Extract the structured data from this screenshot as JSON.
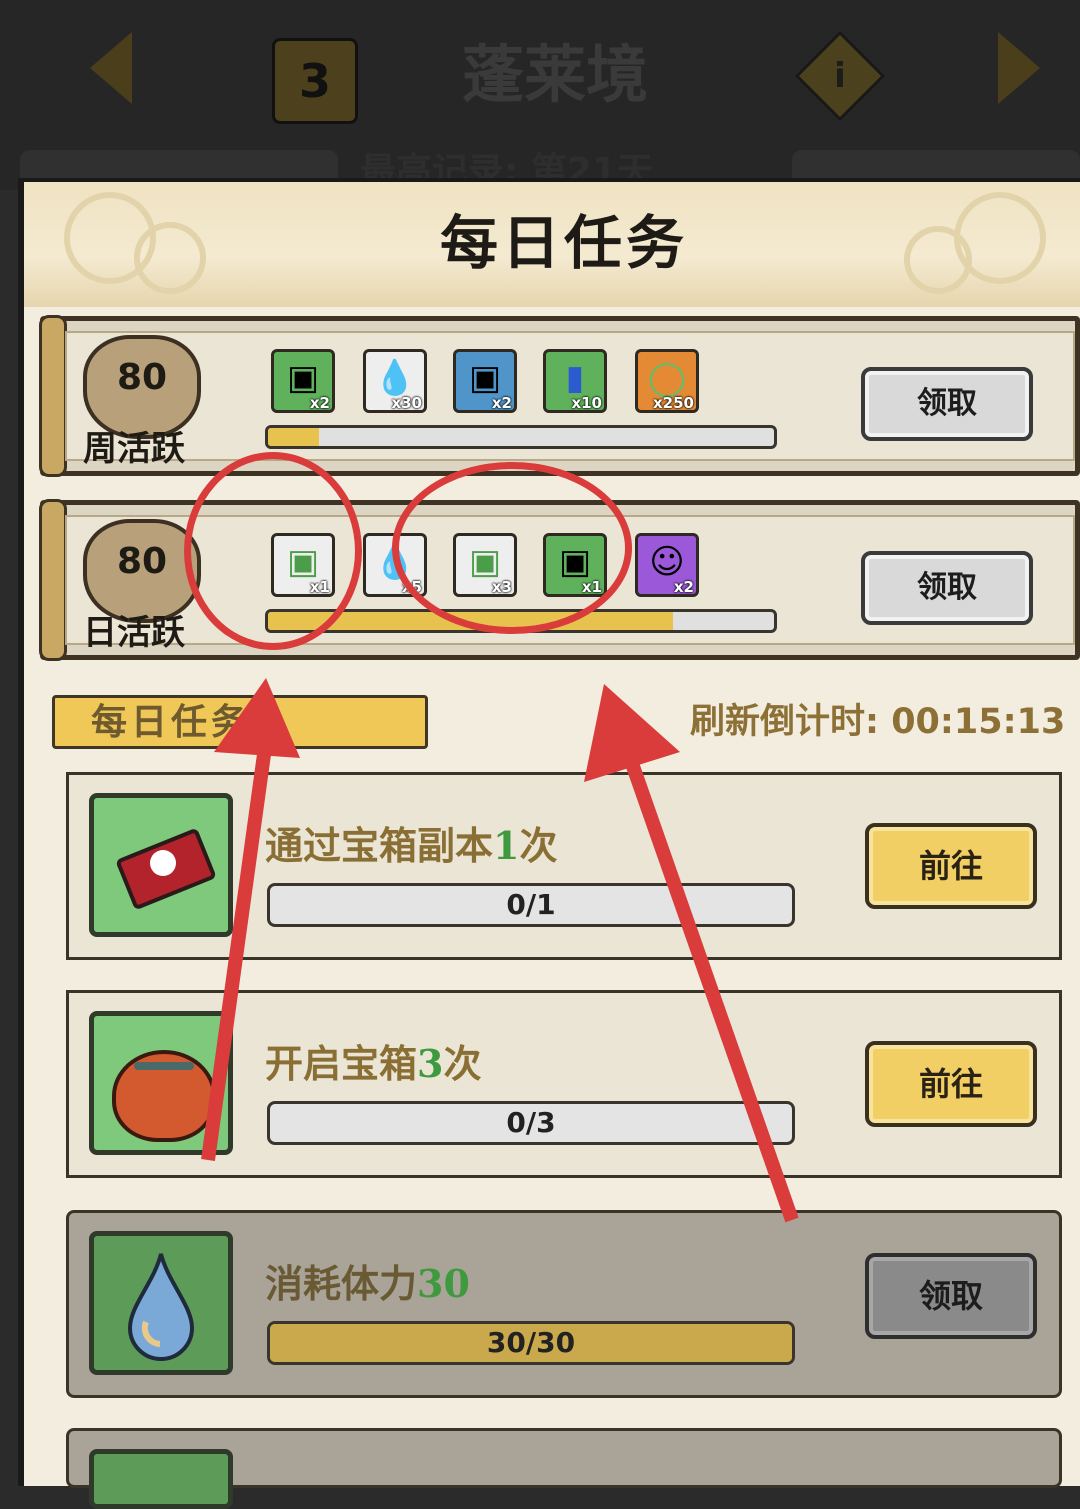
{
  "header": {
    "level": "3",
    "region_title": "蓬莱境",
    "info_icon": "info-icon",
    "record_text": "最高记录: 第21天"
  },
  "panel": {
    "title": "每日任务"
  },
  "weekly": {
    "points": "80",
    "label": "周活跃",
    "progress": 0.1,
    "claim_label": "领取",
    "rewards": [
      {
        "icon": "green-chest-icon",
        "qty": "x2"
      },
      {
        "icon": "water-drop-icon",
        "qty": "x30"
      },
      {
        "icon": "blue-chest-icon",
        "qty": "x2"
      },
      {
        "icon": "blue-card-icon",
        "qty": "x10"
      },
      {
        "icon": "jade-ring-icon",
        "qty": "x250"
      }
    ]
  },
  "daily": {
    "points": "80",
    "label": "日活跃",
    "progress": 0.8,
    "claim_label": "领取",
    "rewards": [
      {
        "icon": "gray-chest-icon",
        "qty": "x1"
      },
      {
        "icon": "water-drop-icon",
        "qty": "x5"
      },
      {
        "icon": "gray-chest-icon",
        "qty": "x3"
      },
      {
        "icon": "green-chest-icon",
        "qty": "x1"
      },
      {
        "icon": "hero-portrait-icon",
        "qty": "x2"
      }
    ]
  },
  "section": {
    "tag": "每日任务",
    "refresh_label": "刷新倒计时: ",
    "refresh_time": "00:15:13"
  },
  "tasks": [
    {
      "icon": "red-ticket-icon",
      "title_pre": "通过宝箱副本",
      "title_num": "1",
      "title_post": "次",
      "progress_text": "0/1",
      "progress": 0.0,
      "button": "前往",
      "state": "go"
    },
    {
      "icon": "red-pouch-icon",
      "title_pre": "开启宝箱",
      "title_num": "3",
      "title_post": "次",
      "progress_text": "0/3",
      "progress": 0.0,
      "button": "前往",
      "state": "go"
    },
    {
      "icon": "water-drop-icon",
      "title_pre": "消耗体力",
      "title_num": "30",
      "title_post": "",
      "progress_text": "30/30",
      "progress": 1.0,
      "button": "领取",
      "state": "claim"
    }
  ],
  "colors": {
    "annotation_red": "#d93c3a",
    "progress_gold": "#e8c24f",
    "go_button": "#f1cf64"
  }
}
